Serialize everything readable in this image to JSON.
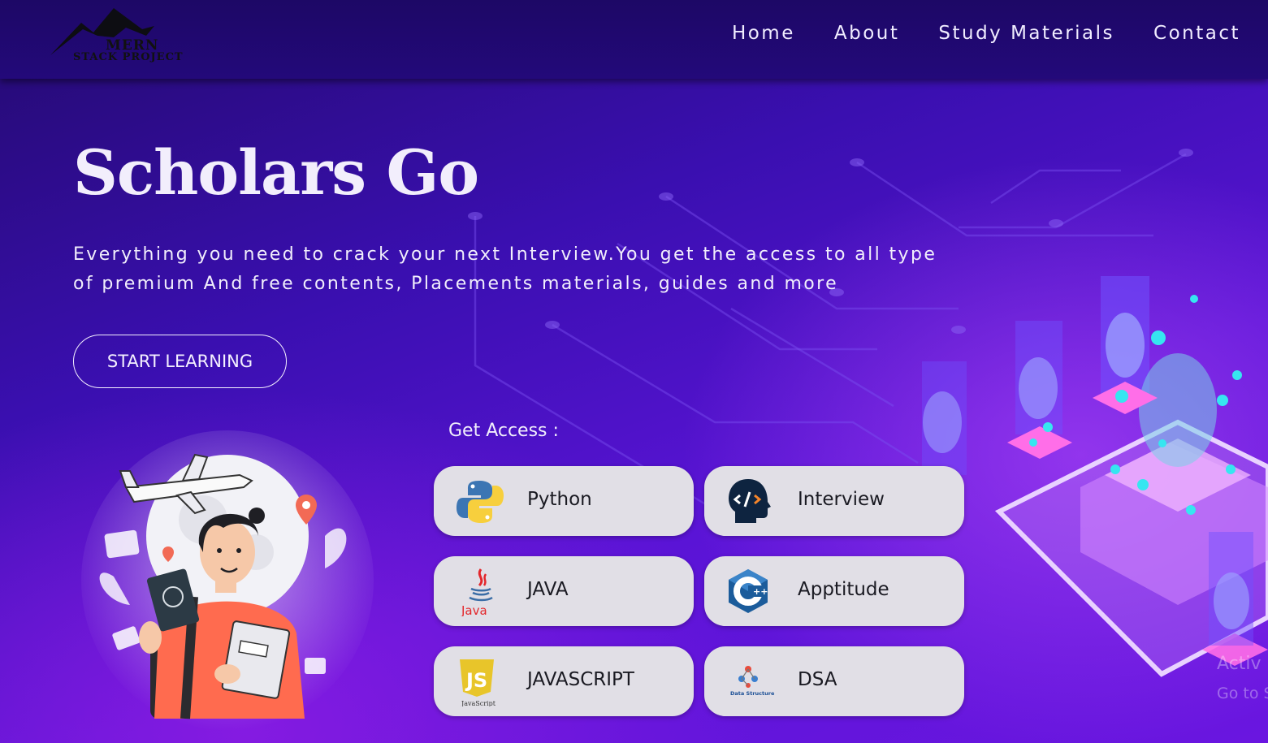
{
  "logo": {
    "line1": "MERN",
    "line2": "STACK PROJECT"
  },
  "nav": {
    "items": [
      {
        "label": "Home"
      },
      {
        "label": "About"
      },
      {
        "label": "Study Materials"
      },
      {
        "label": "Contact"
      }
    ]
  },
  "hero": {
    "title": "Scholars Go",
    "subtitle_line1": "Everything you need to crack your next Interview.You get the access to all type",
    "subtitle_line2": "of premium And free contents, Placements materials, guides and more",
    "cta_label": "START LEARNING"
  },
  "access": {
    "label": "Get Access :",
    "cards": [
      {
        "label": "Python",
        "icon": "python-logo-icon",
        "icon_text": ""
      },
      {
        "label": "Interview",
        "icon": "coder-head-icon",
        "icon_text": ""
      },
      {
        "label": "JAVA",
        "icon": "java-logo-icon",
        "icon_text": "Java"
      },
      {
        "label": "Apptitude",
        "icon": "cpp-logo-icon",
        "icon_text": ""
      },
      {
        "label": "JAVASCRIPT",
        "icon": "javascript-logo-icon",
        "icon_text": "JavaScript"
      },
      {
        "label": "DSA",
        "icon": "data-structure-icon",
        "icon_text": "Data Structure"
      }
    ]
  },
  "watermark": {
    "line1": "Activ",
    "line2": "Go to S"
  },
  "colors": {
    "nav_bg": "#1d0866",
    "hero_bg": "#3a0fb0",
    "card_bg": "#e1dfe6",
    "text_light": "#f1eefc"
  }
}
